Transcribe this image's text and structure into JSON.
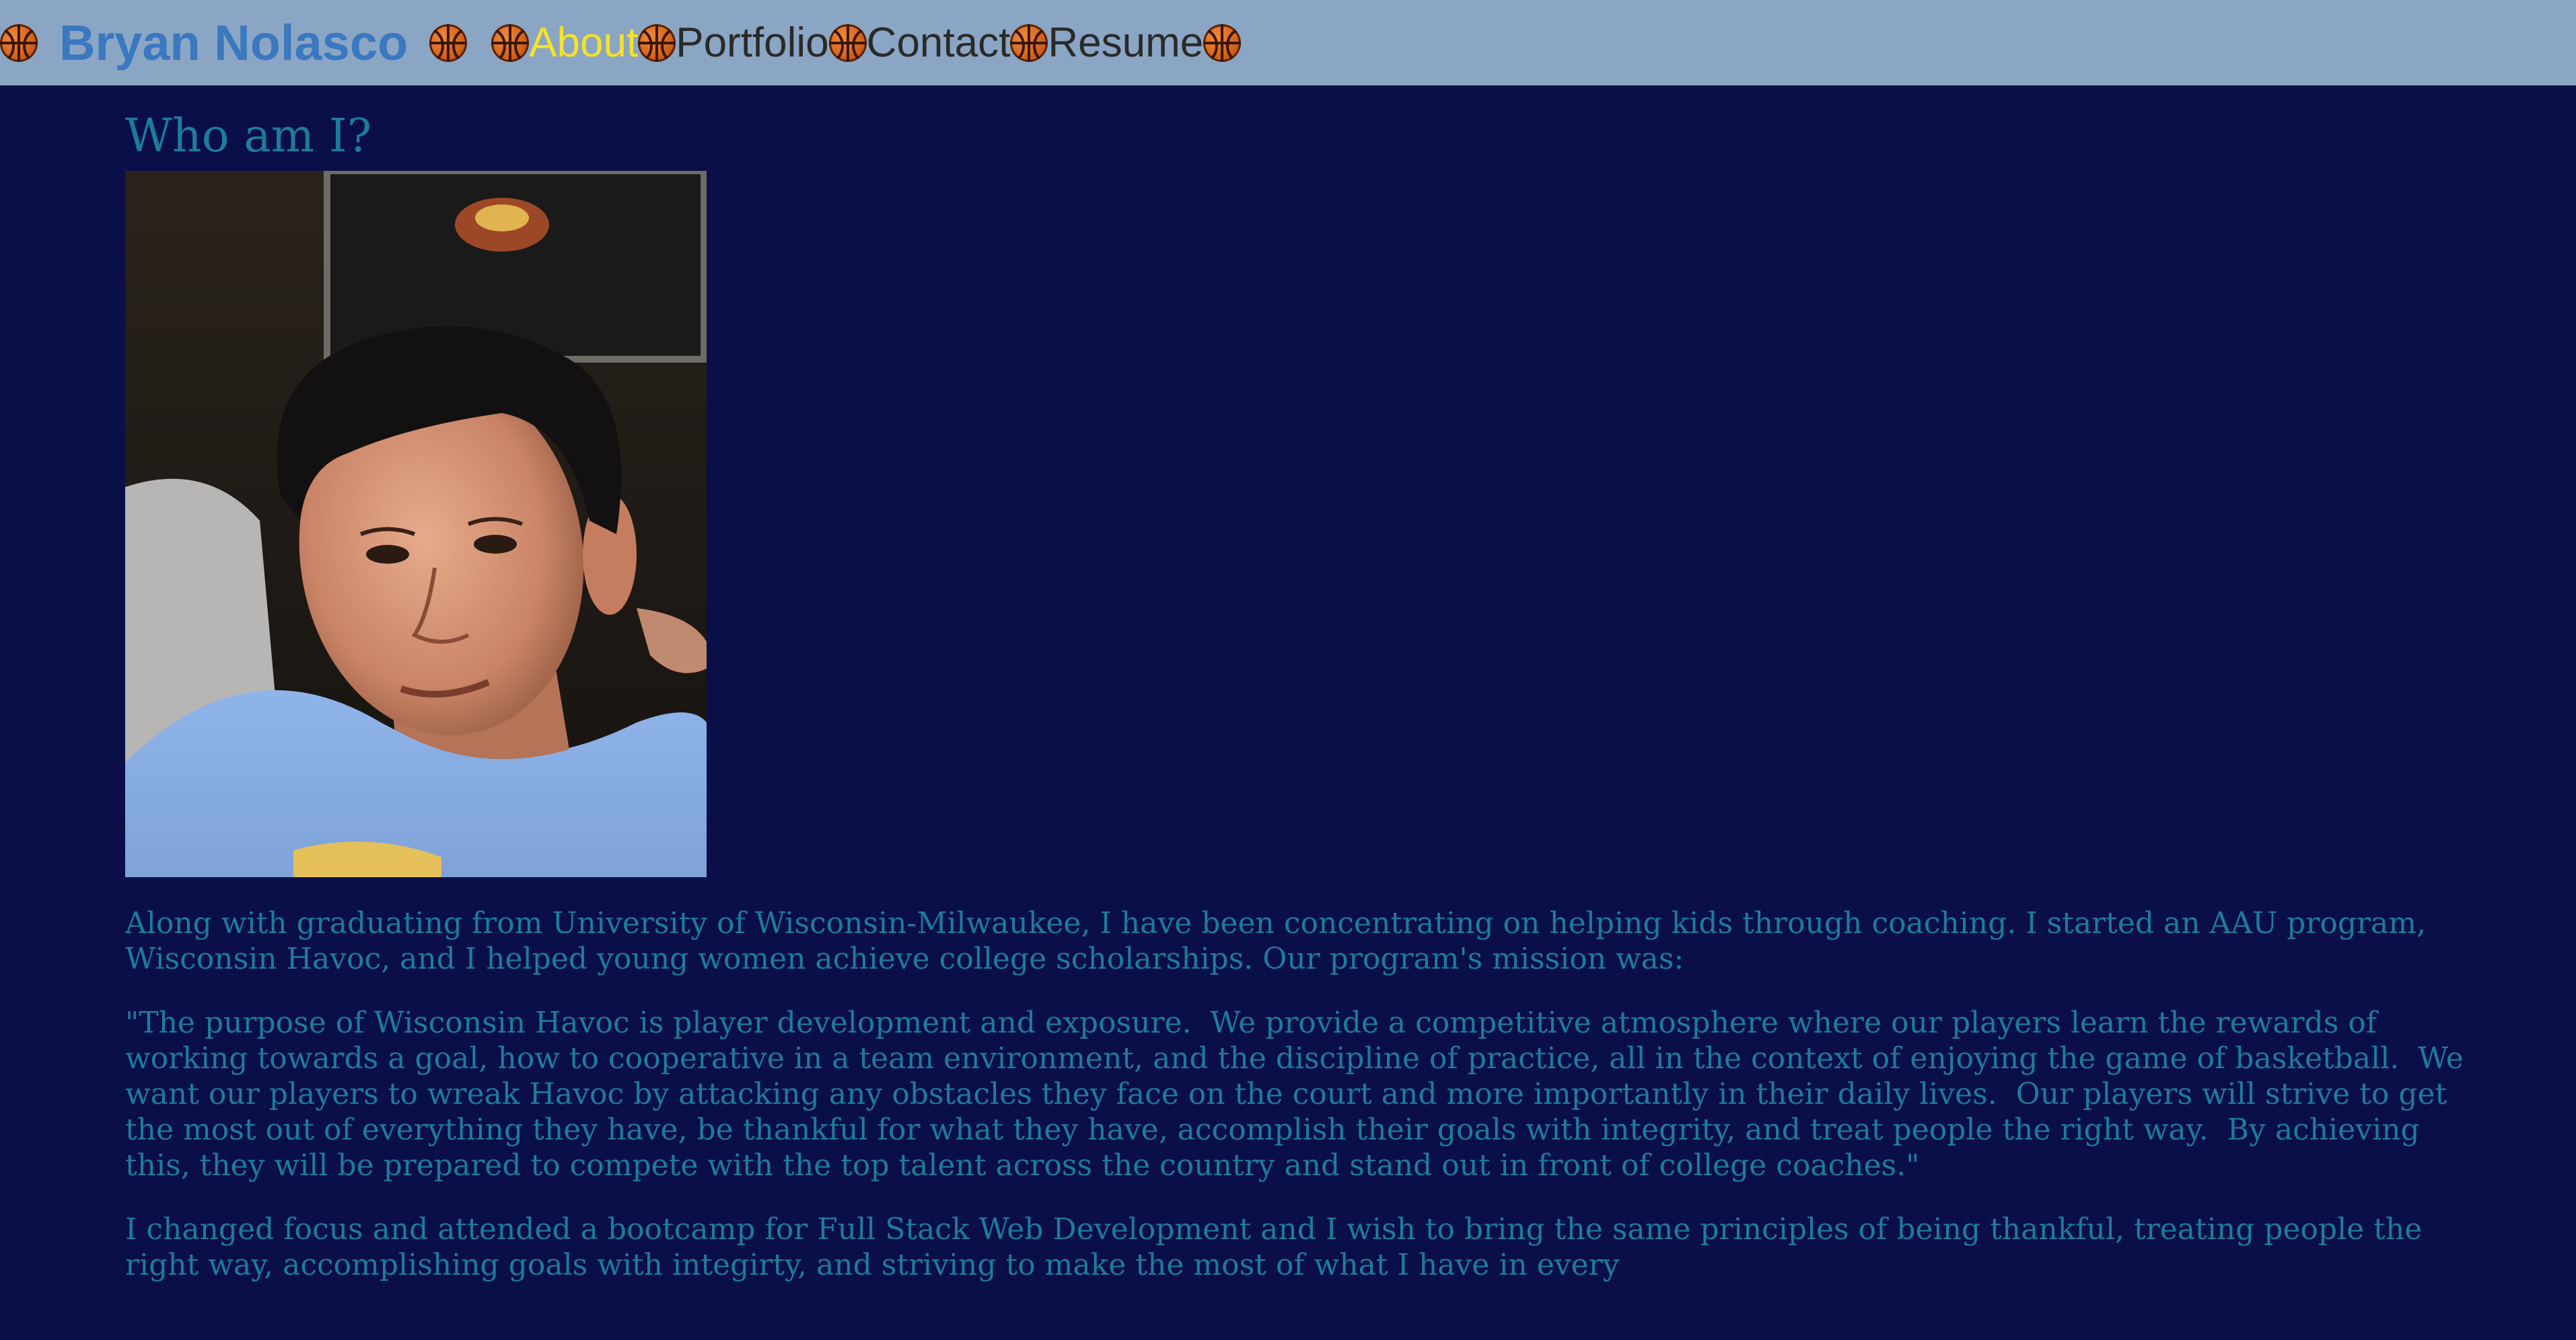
{
  "header": {
    "brand": "Bryan Nolasco",
    "nav": [
      {
        "label": "About",
        "active": true
      },
      {
        "label": "Portfolio",
        "active": false
      },
      {
        "label": "Contact",
        "active": false
      },
      {
        "label": "Resume",
        "active": false
      }
    ],
    "icon": "basketball-icon"
  },
  "main": {
    "heading": "Who am I?",
    "paragraphs": [
      "Along with graduating from University of Wisconsin-Milwaukee, I have been concentrating on helping kids through coaching. I started an AAU program, Wisconsin Havoc, and I helped young women achieve college scholarships. Our program's mission was:",
      "\"The purpose of Wisconsin Havoc is player development and exposure.  We provide a competitive atmosphere where our players learn the rewards of working towards a goal, how to cooperative in a team environment, and the discipline of practice, all in the context of enjoying the game of basketball.  We want our players to wreak Havoc by attacking any obstacles they face on the court and more importantly in their daily lives.  Our players will strive to get the most out of everything they have, be thankful for what they have, accomplish their goals with integrity, and treat people the right way.  By achieving this, they will be prepared to compete with the top talent across the country and stand out in front of college coaches.\"",
      "I changed focus and attended a bootcamp for Full Stack Web Development and I wish to bring the same principles of being thankful, treating people the right way, accomplishing goals with integirty, and striving to make the most of what I have in every"
    ]
  },
  "colors": {
    "navbar_bg": "#8aa6c4",
    "page_bg": "#0a0f48",
    "brand": "#3a78c0",
    "active_link": "#f5e22a",
    "text": "#1d7c9a"
  }
}
